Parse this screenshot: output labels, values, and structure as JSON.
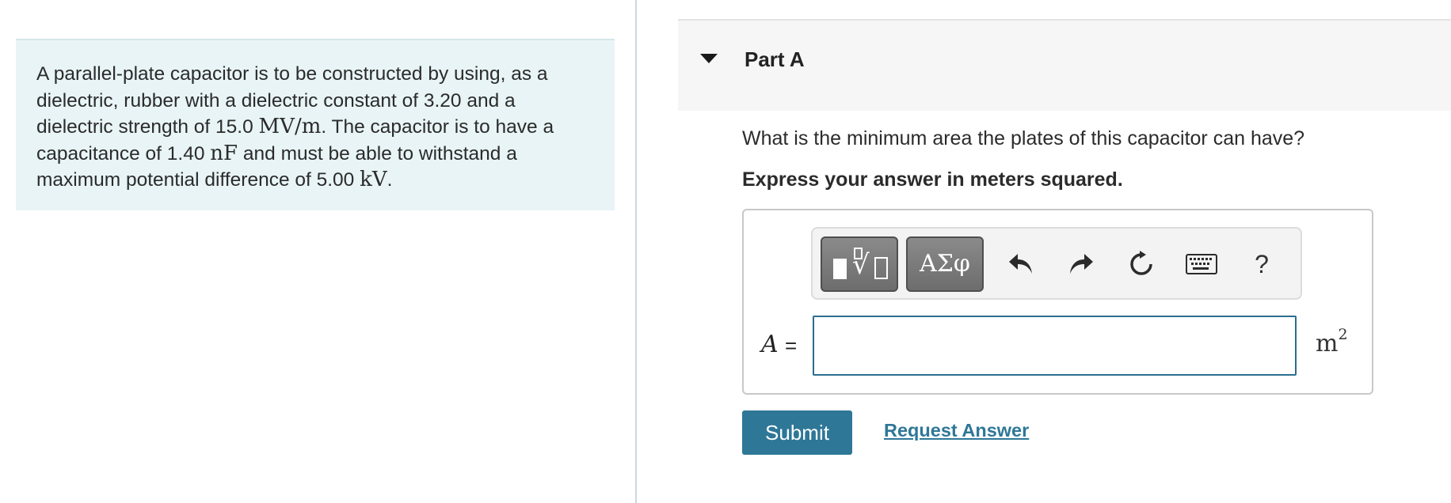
{
  "problem": {
    "line1": "A parallel-plate capacitor is to be constructed by using, as a",
    "line2": "dielectric, rubber with a dielectric constant of 3.20 and a",
    "line3_pre": "dielectric strength of 15.0 ",
    "line3_math": "MV/m",
    "line3_post": ". The capacitor is to have a",
    "line4_pre": "capacitance of 1.40 ",
    "line4_math": "nF",
    "line4_post": " and must be able to withstand a",
    "line5_pre": "maximum potential difference of 5.00 ",
    "line5_math": "kV",
    "line5_post": "."
  },
  "part": {
    "title": "Part A"
  },
  "question": {
    "text": "What is the minimum area the plates of this capacitor can have?",
    "instruction": "Express your answer in meters squared."
  },
  "toolbar": {
    "greek_label": "ΑΣφ",
    "help_label": "?",
    "icons": [
      "templates-icon",
      "greek-letters-icon",
      "undo-icon",
      "redo-icon",
      "reset-icon",
      "keyboard-icon",
      "help-icon"
    ]
  },
  "answer": {
    "variable": "A",
    "equals": "=",
    "value": "",
    "unit_base": "m",
    "unit_exp": "2"
  },
  "actions": {
    "submit_label": "Submit",
    "request_label": "Request Answer"
  },
  "colors": {
    "accent": "#2e7797",
    "problem_bg": "#e8f4f6"
  }
}
